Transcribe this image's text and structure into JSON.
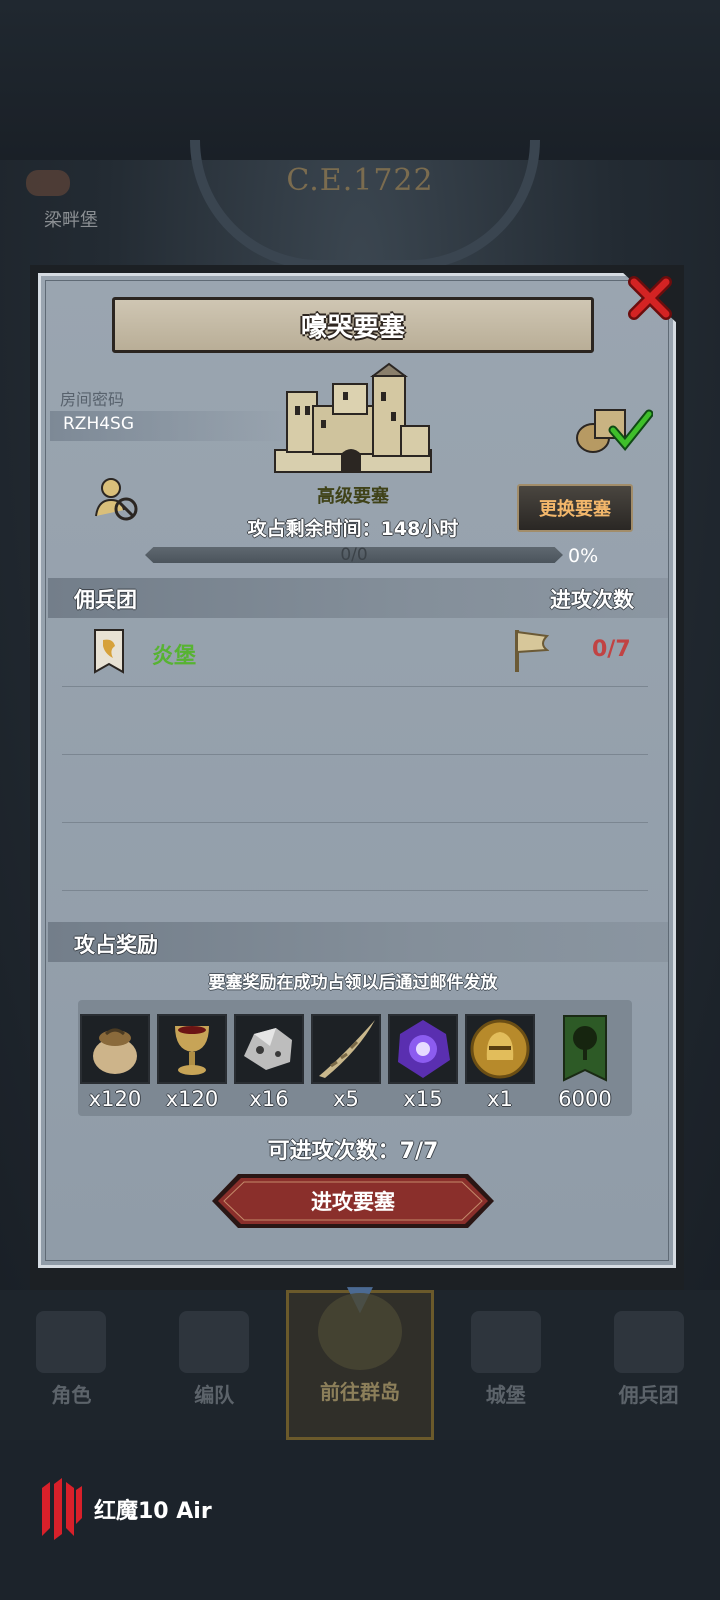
{
  "background": {
    "year": "C.E.1722",
    "left_label": "梁畔堡"
  },
  "dialog": {
    "title": "嚎哭要塞",
    "room_label": "房间密码",
    "room_code": "RZH4SG",
    "fortress_type": "高级要塞",
    "change_button": "更换要塞",
    "time_label": "攻占剩余时间：148小时",
    "progress_text": "0/0",
    "progress_percent": "0%",
    "progress_fraction": 0,
    "mercenary_header": "佣兵团",
    "attack_count_header": "进攻次数",
    "mercenaries": [
      {
        "name": "炎堡",
        "count": "0/7"
      }
    ],
    "reward_header": "攻占奖励",
    "reward_note": "要塞奖励在成功占领以后通过邮件发放",
    "rewards": [
      {
        "icon": "grain-sack-icon",
        "qty": "x120"
      },
      {
        "icon": "goblet-icon",
        "qty": "x120"
      },
      {
        "icon": "ore-icon",
        "qty": "x16"
      },
      {
        "icon": "horn-icon",
        "qty": "x5"
      },
      {
        "icon": "purple-crystal-icon",
        "qty": "x15"
      },
      {
        "icon": "knight-helmet-coin-icon",
        "qty": "x1"
      },
      {
        "icon": "tree-banner-icon",
        "qty": "6000"
      }
    ],
    "attempts": "可进攻次数：7/7",
    "attack_button": "进攻要塞"
  },
  "bottom_nav": [
    {
      "label": "角色",
      "icon": "knight-icon",
      "active": false
    },
    {
      "label": "编队",
      "icon": "formation-icon",
      "active": false
    },
    {
      "label": "前往群岛",
      "icon": "islands-icon",
      "active": true
    },
    {
      "label": "城堡",
      "icon": "castle-icon",
      "active": false
    },
    {
      "label": "佣兵团",
      "icon": "mercenary-icon",
      "active": false
    }
  ],
  "watermark": "红魔10 Air",
  "colors": {
    "merc_name": "#57b332",
    "merc_count": "#c14343",
    "change_button_text": "#f3b76b",
    "attack_button": "#8a2f2b"
  }
}
